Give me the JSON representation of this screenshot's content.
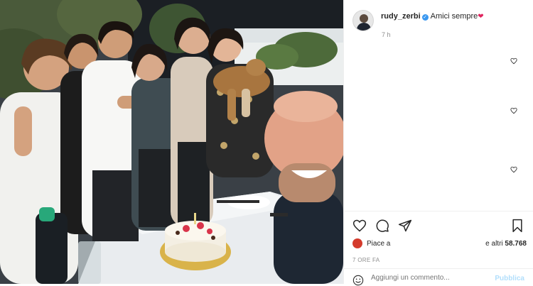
{
  "post": {
    "username": "rudy_zerbi",
    "verified": true,
    "caption": "Amici sempre",
    "caption_emoji": "❤",
    "timestamp": "7 h"
  },
  "comments": [
    {
      "like_icon": "heart-outline-icon"
    },
    {
      "like_icon": "heart-outline-icon"
    },
    {
      "like_icon": "heart-outline-icon"
    }
  ],
  "actions": {
    "like": "heart-outline-icon",
    "comment": "comment-bubble-icon",
    "share": "paper-plane-icon",
    "save": "bookmark-icon"
  },
  "likes": {
    "prefix": "Piace a",
    "suffix_text": "e altri",
    "count": "58.768"
  },
  "date_label": "7 ORE FA",
  "comment_box": {
    "placeholder": "Aggiungi un commento...",
    "publish_label": "Pubblica",
    "emoji_icon": "smiley-icon"
  },
  "colors": {
    "verified": "#3897f0",
    "heart": "#e0245e",
    "publish": "#b2dffc",
    "muted": "#8e8e8e"
  }
}
